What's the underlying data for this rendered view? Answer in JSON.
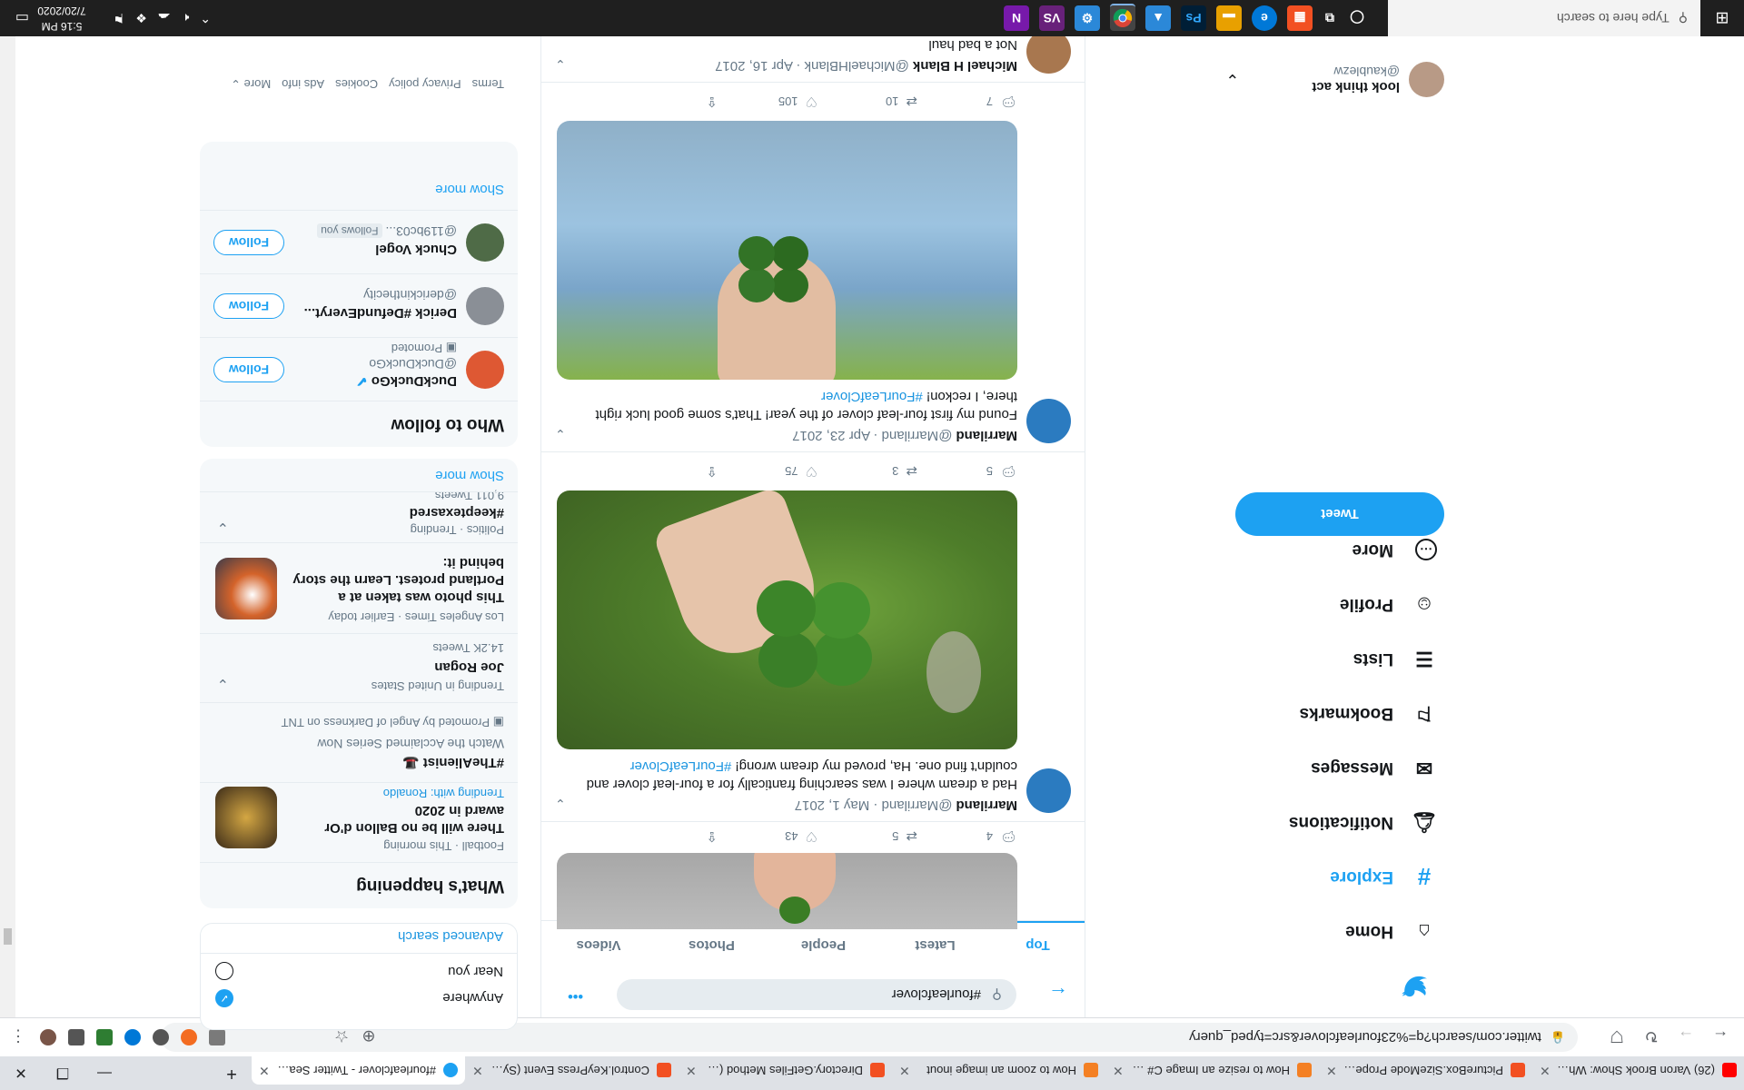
{
  "browser": {
    "tabs": [
      {
        "title": "(26) Varon Brook Show: What is",
        "color": "#ff0000"
      },
      {
        "title": "PictureBox.SizeMode Property (S",
        "color": "#f25022"
      },
      {
        "title": "How to resize an Image C# - Sta",
        "color": "#f48024"
      },
      {
        "title": "How to zoom an image inout",
        "color": "#f48024"
      },
      {
        "title": "Directory.GetFiles Method (Syste",
        "color": "#f25022"
      },
      {
        "title": "Control.KeyPress Event (System.W",
        "color": "#f25022"
      },
      {
        "title": "#fourleafclover - Twitter Search",
        "color": "#1da1f2"
      }
    ],
    "new_tab": "+",
    "url": "twitter.com/search?q=%23fourleafclover&src=typed_query"
  },
  "twitter": {
    "nav": [
      {
        "label": "Home",
        "icon": "home-icon",
        "glyph": "⌂"
      },
      {
        "label": "Explore",
        "icon": "hashtag-icon",
        "glyph": "#"
      },
      {
        "label": "Notifications",
        "icon": "bell-icon",
        "glyph": "♫"
      },
      {
        "label": "Messages",
        "icon": "mail-icon",
        "glyph": "✉"
      },
      {
        "label": "Bookmarks",
        "icon": "bookmark-icon",
        "glyph": "⚐"
      },
      {
        "label": "Lists",
        "icon": "list-icon",
        "glyph": "☰"
      },
      {
        "label": "Profile",
        "icon": "person-icon",
        "glyph": "☺"
      },
      {
        "label": "More",
        "icon": "more-circle-icon",
        "glyph": "⋯"
      }
    ],
    "tweet_button": "Tweet",
    "account": {
      "name": "look think act",
      "handle": "@kaublezw",
      "chevron": "⌄"
    },
    "search": {
      "query": "#fourleafclover",
      "more": "•••",
      "back": "←"
    },
    "search_tabs": [
      "Top",
      "Latest",
      "People",
      "Photos",
      "Videos"
    ],
    "tweets": [
      {
        "name": "Marriland",
        "meta": "@Marriland · May 1, 2017",
        "text": "Had a dream where I was searching frantically for a four-leaf clover and couldn't find one. Ha, proved my dream wrong! ",
        "hashtag": "#FourLeafClover",
        "replies": "5",
        "retweets": "3",
        "likes": "75"
      },
      {
        "name": "Marriland",
        "meta": "@Marriland · Apr 23, 2017",
        "text": "Found my first four-leaf clover of the year! That's some good luck right there, I reckon! ",
        "hashtag": "#FourLeafClover",
        "replies": "7",
        "retweets": "10",
        "likes": "105"
      },
      {
        "name": "Michael H Blank",
        "meta": "@MichaelHBlank · Apr 16, 2017",
        "text": "Not a bad haul",
        "hashtag": ""
      }
    ],
    "bottom_tweet_actions": {
      "replies": "4",
      "retweets": "5",
      "likes": "43"
    },
    "search_filters": {
      "location_anywhere": "Anywhere",
      "location_near": "Near you",
      "advanced": "Advanced search"
    },
    "whats_happening": {
      "title": "What's happening",
      "items": [
        {
          "context": "Football · This morning",
          "headline": "There will be no Ballon d'Or award in 2020",
          "sub": "Trending with: Ronaldo"
        },
        {
          "context": "",
          "headline": "#TheAlienist 🎩",
          "sub": "Watch the Acclaimed Series Now",
          "promo": "Promoted by Angel of Darkness on TNT"
        },
        {
          "context": "Trending in United States",
          "headline": "Joe Rogan",
          "sub": "14.2K Tweets"
        },
        {
          "context": "Los Angeles Times · Earlier today",
          "headline": "This photo was taken at a Portland protest. Learn the story behind it:",
          "sub": ""
        },
        {
          "context": "Politics · Trending",
          "headline": "#keeptexasred",
          "sub": "9,011 Tweets"
        }
      ],
      "show_more": "Show more"
    },
    "who_to_follow": {
      "title": "Who to follow",
      "people": [
        {
          "name": "DuckDuckGo",
          "handle": "@DuckDuckGo",
          "extra": "Promoted",
          "button": "Follow"
        },
        {
          "name": "Derick #DefundEveryt...",
          "handle": "@derickinthecity",
          "extra": "",
          "button": "Follow"
        },
        {
          "name": "Chuck Vogel",
          "handle": "@119bc03...",
          "extra": "Follows you",
          "button": "Follow"
        }
      ],
      "show_more": "Show more"
    },
    "footer": [
      "Terms",
      "Privacy policy",
      "Cookies",
      "Ads info",
      "More ⌄"
    ]
  },
  "taskbar": {
    "search_placeholder": "Type here to search",
    "time": "5:16 PM",
    "date": "7/20/2020",
    "apps": [
      {
        "label": "◯",
        "color": "#1f1f1f"
      },
      {
        "label": "⧉",
        "color": "#1f1f1f"
      },
      {
        "label": "▦",
        "color": "#f25022"
      },
      {
        "label": "e",
        "color": "#0078d7"
      },
      {
        "label": "▬",
        "color": "#e8a000"
      },
      {
        "label": "Ps",
        "color": "#001e36"
      },
      {
        "label": "▲",
        "color": "#2b88d8"
      },
      {
        "label": "◉",
        "color": "#444"
      },
      {
        "label": "⚙",
        "color": "#2b88d8"
      },
      {
        "label": "VS",
        "color": "#68217a"
      },
      {
        "label": "N",
        "color": "#7719aa"
      }
    ]
  },
  "colors": {
    "twitter_blue": "#1da1f2",
    "link": "#1b95e0",
    "muted": "#657786"
  }
}
